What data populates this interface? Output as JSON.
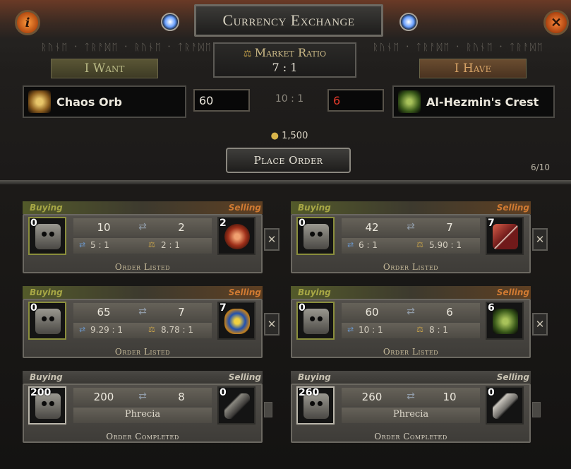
{
  "window": {
    "title": "Currency Exchange"
  },
  "market": {
    "label": "Market Ratio",
    "value": "7 : 1"
  },
  "tabs": {
    "want": "I Want",
    "have": "I Have"
  },
  "want": {
    "item": "Chaos Orb",
    "qty": "60",
    "icon": "chaos-orb-icon"
  },
  "have": {
    "item": "Al-Hezmin's Crest",
    "qty": "6",
    "icon": "al-hezmins-crest-icon"
  },
  "ratio_mid": "10 : 1",
  "gold": "1,500",
  "place_order": "Place Order",
  "page_count": "6/10",
  "orders": [
    {
      "buying": "Buying",
      "selling": "Selling",
      "left_qty": "0",
      "right_qty": "2",
      "v1": "10",
      "v2": "2",
      "r1": "5 : 1",
      "r2": "2 : 1",
      "status": "Order Listed"
    },
    {
      "buying": "Buying",
      "selling": "Selling",
      "left_qty": "0",
      "right_qty": "7",
      "v1": "42",
      "v2": "7",
      "r1": "6 : 1",
      "r2": "5.90 : 1",
      "status": "Order Listed"
    },
    {
      "buying": "Buying",
      "selling": "Selling",
      "left_qty": "0",
      "right_qty": "7",
      "v1": "65",
      "v2": "7",
      "r1": "9.29 : 1",
      "r2": "8.78 : 1",
      "status": "Order Listed"
    },
    {
      "buying": "Buying",
      "selling": "Selling",
      "left_qty": "0",
      "right_qty": "6",
      "v1": "60",
      "v2": "6",
      "r1": "10 : 1",
      "r2": "8 : 1",
      "status": "Order Listed"
    },
    {
      "buying": "Buying",
      "selling": "Selling",
      "left_qty": "200",
      "right_qty": "0",
      "v1": "200",
      "v2": "8",
      "seller": "Phrecia",
      "status": "Order Completed"
    },
    {
      "buying": "Buying",
      "selling": "Selling",
      "left_qty": "260",
      "right_qty": "0",
      "v1": "260",
      "v2": "10",
      "seller": "Phrecia",
      "status": "Order Completed"
    }
  ],
  "colors": {
    "buying": "#a7a745",
    "selling": "#d07a32",
    "have_qty": "#e23a2a",
    "market_label": "#cbb986"
  }
}
